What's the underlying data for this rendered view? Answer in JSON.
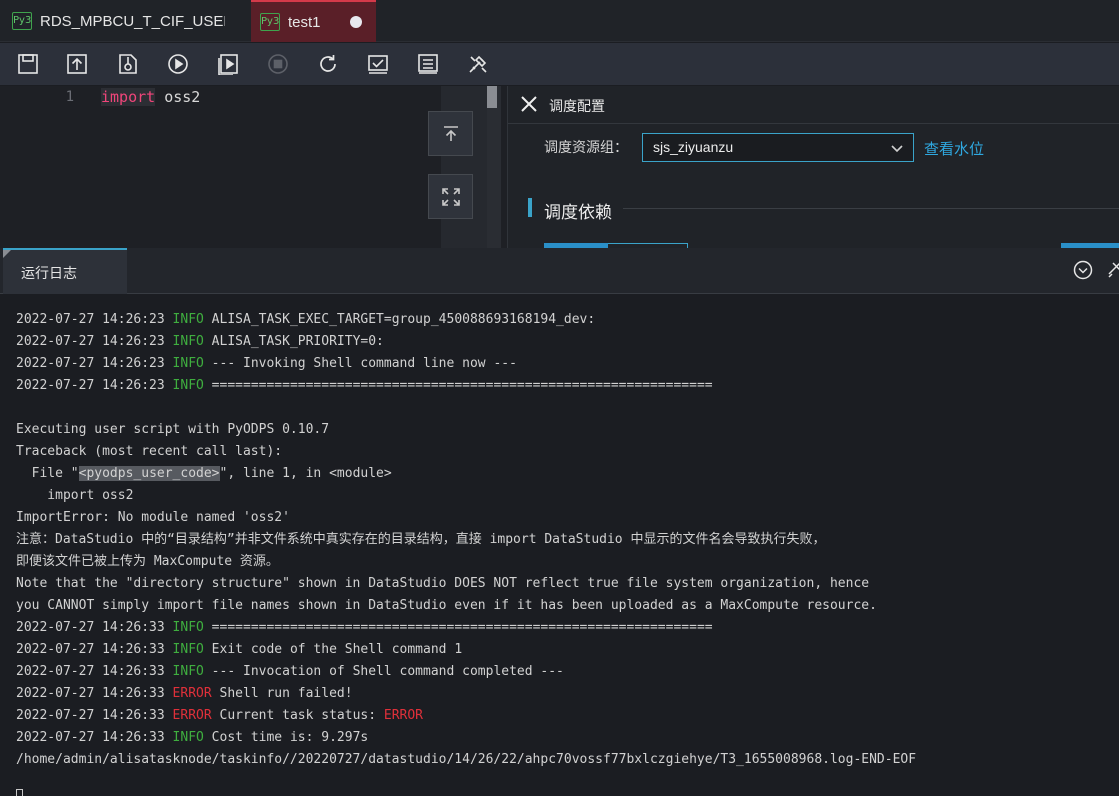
{
  "tabs": [
    {
      "badge": "Py3",
      "title": "RDS_MPBCU_T_CIF_USER..."
    },
    {
      "badge": "Py3",
      "title": "test1"
    }
  ],
  "toolbar": {
    "icons": [
      "save-icon",
      "submit-icon",
      "publish-icon",
      "run-icon",
      "run-with-params-icon",
      "stop-icon",
      "reload-icon",
      "check-icon",
      "format-icon",
      "tools-icon"
    ]
  },
  "editor": {
    "line_number": "1",
    "keyword": "import",
    "identifier": " oss2"
  },
  "schedule_panel": {
    "title": "调度配置",
    "resource_group_label": "调度资源组：",
    "resource_group_value": "sjs_ziyuanzu",
    "view_watermark_link": "查看水位",
    "dependency_title": "调度依赖"
  },
  "log_panel": {
    "tab_title": "运行日志",
    "lines": [
      {
        "ts": "2022-07-27 14:26:23 ",
        "level": "INFO",
        "msg": " ALISA_TASK_EXEC_TARGET=group_450088693168194_dev:"
      },
      {
        "ts": "2022-07-27 14:26:23 ",
        "level": "INFO",
        "msg": " ALISA_TASK_PRIORITY=0:"
      },
      {
        "ts": "2022-07-27 14:26:23 ",
        "level": "INFO",
        "msg": " --- Invoking Shell command line now ---"
      },
      {
        "ts": "2022-07-27 14:26:23 ",
        "level": "INFO",
        "msg": " ================================================================"
      },
      {
        "text": ""
      },
      {
        "text": "Executing user script with PyODPS 0.10.7"
      },
      {
        "text": "Traceback (most recent call last):"
      },
      {
        "pre": "  File \"",
        "hl": "<pyodps_user_code>",
        "post": "\", line 1, in <module>"
      },
      {
        "text": "    import oss2"
      },
      {
        "text": "ImportError: No module named 'oss2'"
      },
      {
        "text": "注意：DataStudio 中的“目录结构”并非文件系统中真实存在的目录结构，直接 import DataStudio 中显示的文件名会导致执行失败，"
      },
      {
        "text": "即便该文件已被上传为 MaxCompute 资源。"
      },
      {
        "text": "Note that the \"directory structure\" shown in DataStudio DOES NOT reflect true file system organization, hence"
      },
      {
        "text": "you CANNOT simply import file names shown in DataStudio even if it has been uploaded as a MaxCompute resource."
      },
      {
        "ts": "2022-07-27 14:26:33 ",
        "level": "INFO",
        "msg": " ================================================================"
      },
      {
        "ts": "2022-07-27 14:26:33 ",
        "level": "INFO",
        "msg": " Exit code of the Shell command 1"
      },
      {
        "ts": "2022-07-27 14:26:33 ",
        "level": "INFO",
        "msg": " --- Invocation of Shell command completed ---"
      },
      {
        "ts": "2022-07-27 14:26:33 ",
        "level": "ERROR",
        "msg": " Shell run failed!"
      },
      {
        "ts": "2022-07-27 14:26:33 ",
        "level": "ERROR",
        "msg": " Current task status: ",
        "trail_level": "ERROR"
      },
      {
        "ts": "2022-07-27 14:26:33 ",
        "level": "INFO",
        "msg": " Cost time is: 9.297s"
      },
      {
        "text": "/home/admin/alisatasknode/taskinfo//20220727/datastudio/14/26/22/ahpc70vossf77bxlczgiehye/T3_1655008968.log-END-EOF"
      }
    ]
  },
  "colors": {
    "accent": "#3aa3c9",
    "active_tab": "#5a1f28",
    "info": "#3fae3f",
    "error": "#e0303a",
    "keyword": "#f0457a"
  }
}
